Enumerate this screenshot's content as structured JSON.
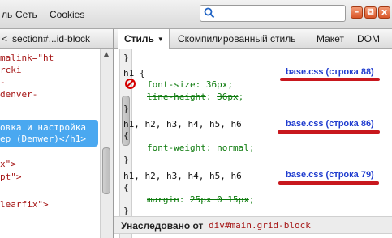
{
  "menu": {
    "items": [
      "ль",
      "Сеть",
      "Cookies"
    ]
  },
  "search": {
    "value": "",
    "placeholder": ""
  },
  "window_buttons": {
    "close": "x",
    "restore": "⧉",
    "minimize": "–"
  },
  "breadcrumb": {
    "arrow": "<",
    "text": "section#...id-block"
  },
  "tabs": {
    "style": "Стиль",
    "computed": "Скомпилированный стиль",
    "layout": "Макет",
    "dom": "DOM"
  },
  "html_tree": {
    "lines": [
      "malink=\"ht",
      "rcki",
      "-",
      "denver-",
      "",
      "",
      "",
      "",
      "",
      "x\">",
      "pt\">",
      "",
      "learfix\">"
    ],
    "selected_lines": [
      "овка и настройка",
      "ер (Denwer)</h1>"
    ]
  },
  "rules": [
    {
      "selector": "h1 {",
      "source": "base.css (строка 88)",
      "props": [
        {
          "name": "font-size",
          "value": "36px",
          "disabled": true,
          "overridden": false
        },
        {
          "name": "line-height",
          "value": "36px",
          "disabled": false,
          "overridden": true
        }
      ],
      "close": "}"
    },
    {
      "selector": "h1, h2, h3, h4, h5, h6",
      "open": "{",
      "source": "base.css (строка 86)",
      "props": [
        {
          "name": "font-weight",
          "value": "normal",
          "disabled": false,
          "overridden": false
        }
      ],
      "close": "}"
    },
    {
      "selector": "h1, h2, h3, h4, h5, h6",
      "open": "{",
      "source": "base.css (строка 79)",
      "props": [
        {
          "name": "margin",
          "value": "25px 0 15px",
          "disabled": false,
          "overridden": true
        }
      ],
      "close": "}"
    }
  ],
  "top_brace": "}",
  "inherited": {
    "label": "Унаследовано от",
    "target": "div#main.grid-block"
  },
  "colors": {
    "selection": "#4aa8f0",
    "source_link": "#1f3ccf",
    "annotation_underline": "#c8171d",
    "property_green": "#0c7a0c",
    "tag_red": "#a51414"
  }
}
